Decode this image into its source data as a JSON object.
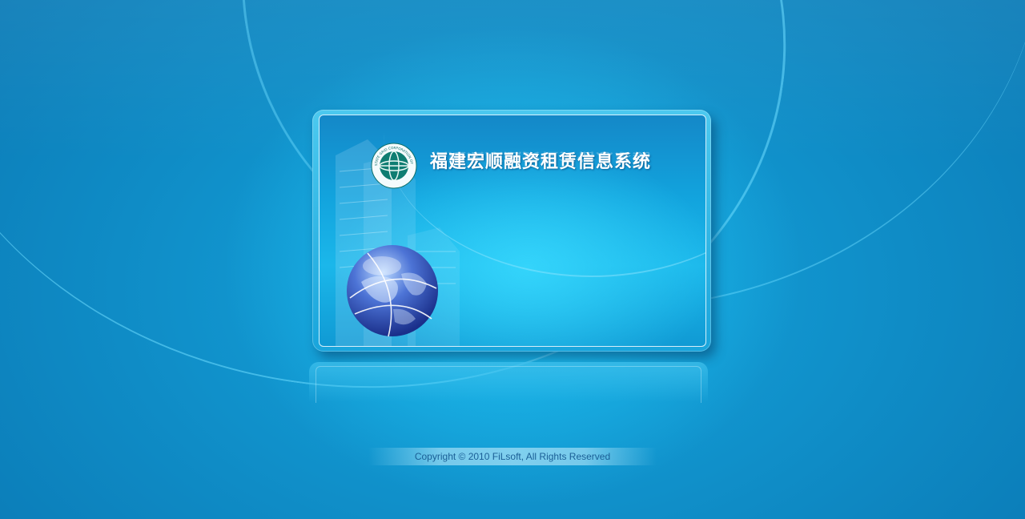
{
  "app": {
    "title": "福建宏顺融资租赁信息系统"
  },
  "logo": {
    "icon": "company-emblem-icon",
    "text": "STATE GRID CORPORATION OF CHINA"
  },
  "decor": {
    "globe_icon": "globe-icon",
    "buildings_icon": "buildings-graphic"
  },
  "footer": {
    "copyright": "Copyright © 2010 FiLsoft, All Rights Reserved"
  },
  "colors": {
    "background": "#0f8cc6",
    "panel": "#19a5dc",
    "footer_text": "#1a5f96"
  }
}
